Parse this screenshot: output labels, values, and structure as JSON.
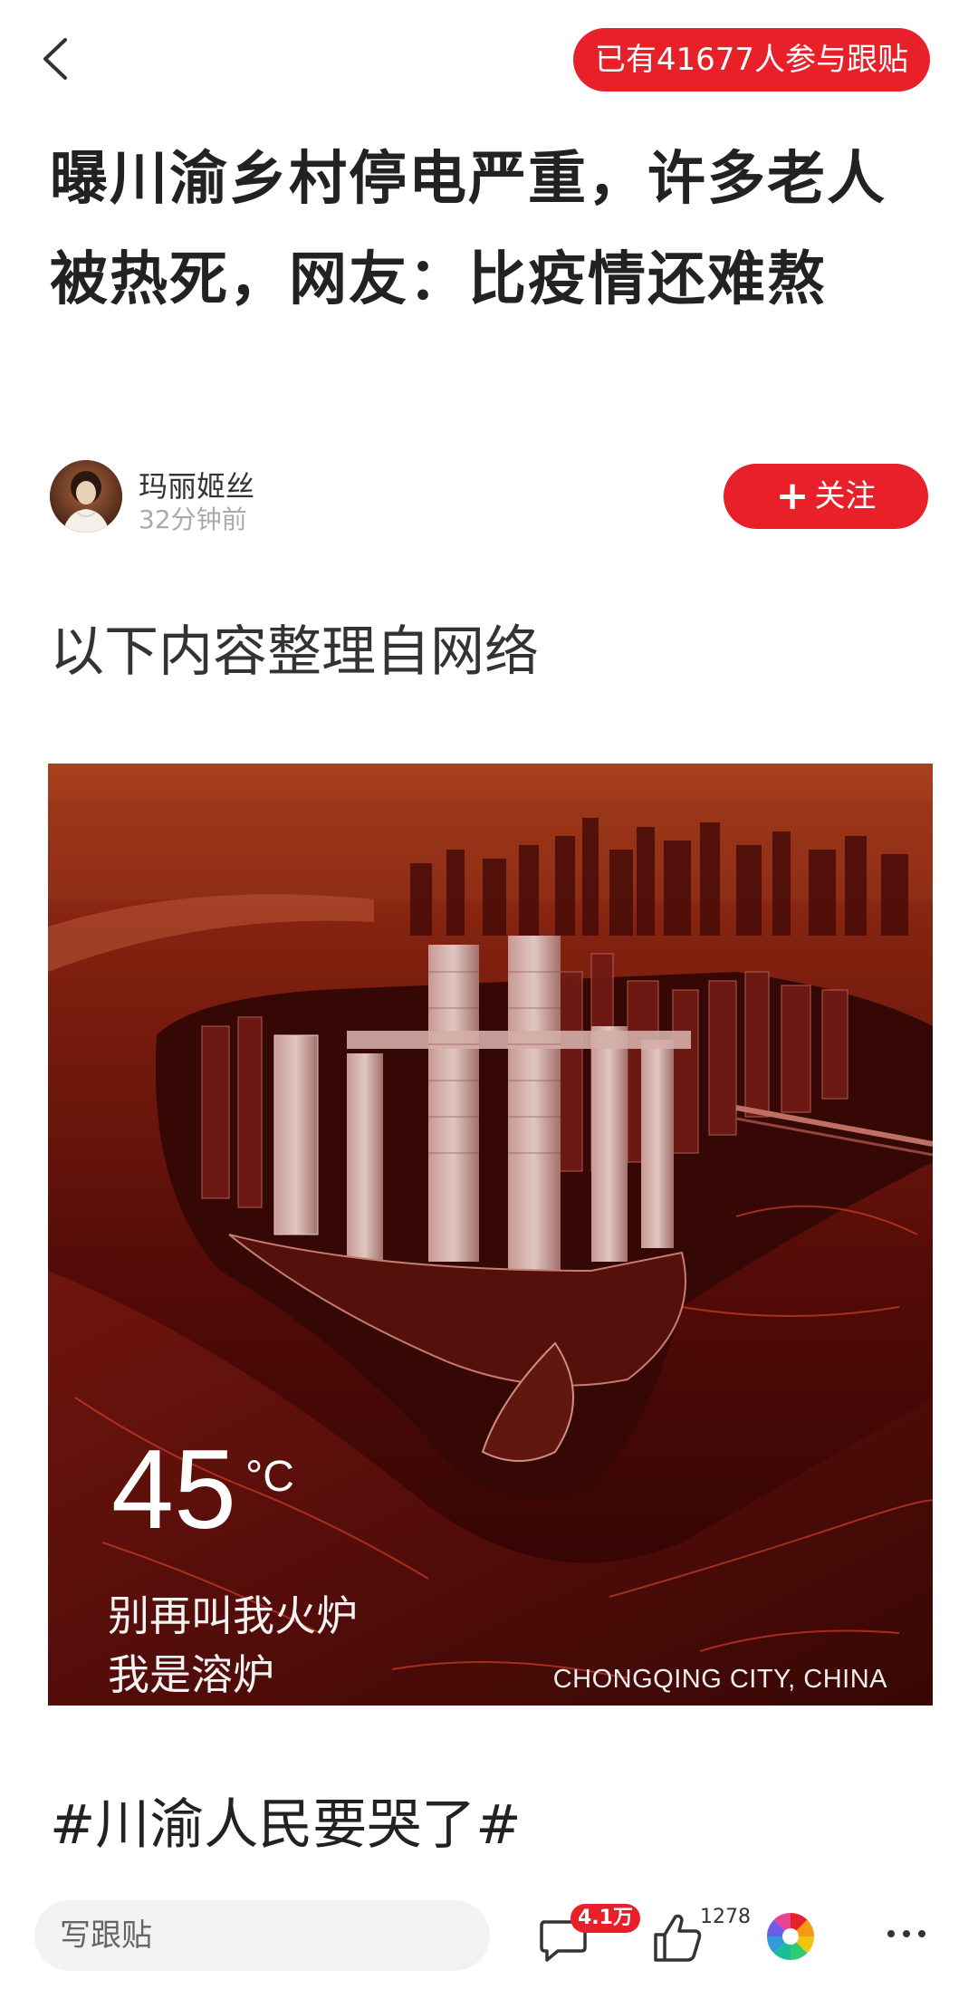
{
  "header": {
    "follow_count_label": "已有41677人参与跟贴"
  },
  "article": {
    "title": "曝川渝乡村停电严重，许多老人被热死，网友：比疫情还难熬",
    "author_name": "玛丽姬丝",
    "post_time": "32分钟前",
    "follow_label": "关注",
    "intro": "以下内容整理自网络",
    "hashtag": "#川渝人民要哭了#"
  },
  "figure": {
    "temperature": "45",
    "degree_unit": "°C",
    "caption_line1": "别再叫我火炉",
    "caption_line2": "我是溶炉",
    "city_label": "CHONGQING CITY, CHINA"
  },
  "bottom_bar": {
    "reply_placeholder": "写跟贴",
    "comment_count": "4.1万",
    "like_count": "1278"
  },
  "icons": {
    "back": "chevron-left-icon",
    "comment": "comment-bubble-icon",
    "like": "thumb-up-icon",
    "share": "pinwheel-share-icon",
    "more": "more-dots-icon"
  },
  "colors": {
    "accent": "#e8202a",
    "text": "#222222",
    "muted": "#aaaaaa"
  }
}
